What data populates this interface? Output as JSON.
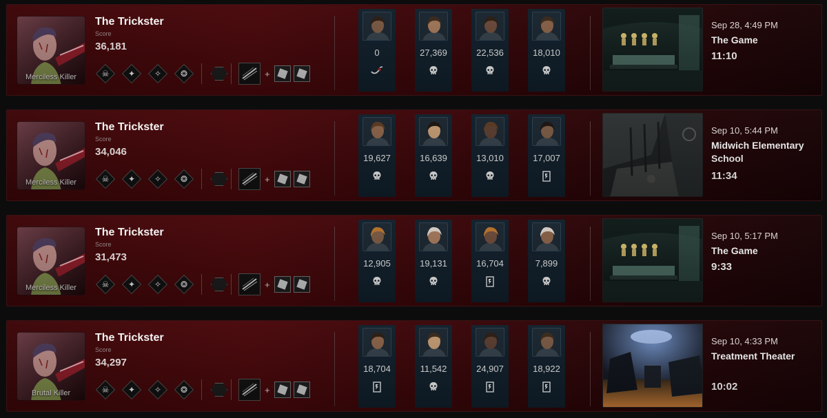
{
  "matches": [
    {
      "killer": "The Trickster",
      "score_label": "Score",
      "score": "36,181",
      "rank": "Merciless Killer",
      "perks": [
        "perk-icon-1",
        "perk-icon-2",
        "perk-icon-3",
        "perk-icon-4"
      ],
      "offering": "offering-icon",
      "power": "power-icon",
      "plus": "+",
      "addons": [
        "addon-icon-1",
        "addon-icon-2"
      ],
      "survivors": [
        {
          "score": "0",
          "status": "hook-icon"
        },
        {
          "score": "27,369",
          "status": "skull-icon"
        },
        {
          "score": "22,536",
          "status": "skull-icon"
        },
        {
          "score": "18,010",
          "status": "skull-icon"
        }
      ],
      "date": "Sep 28, 4:49 PM",
      "map": "The Game",
      "duration": "11:10"
    },
    {
      "killer": "The Trickster",
      "score_label": "Score",
      "score": "34,046",
      "rank": "Merciless Killer",
      "perks": [
        "perk-icon-1",
        "perk-icon-2",
        "perk-icon-3",
        "perk-icon-4"
      ],
      "offering": "offering-icon",
      "power": "power-icon",
      "plus": "+",
      "addons": [
        "addon-icon-1",
        "addon-icon-2"
      ],
      "survivors": [
        {
          "score": "19,627",
          "status": "skull-icon"
        },
        {
          "score": "16,639",
          "status": "skull-icon"
        },
        {
          "score": "13,010",
          "status": "skull-icon"
        },
        {
          "score": "17,007",
          "status": "escape-icon"
        }
      ],
      "date": "Sep 10, 5:44 PM",
      "map": "Midwich Elementary School",
      "duration": "11:34"
    },
    {
      "killer": "The Trickster",
      "score_label": "Score",
      "score": "31,473",
      "rank": "Merciless Killer",
      "perks": [
        "perk-icon-1",
        "perk-icon-2",
        "perk-icon-3",
        "perk-icon-4"
      ],
      "offering": "offering-icon",
      "power": "power-icon",
      "plus": "+",
      "addons": [
        "addon-icon-1",
        "addon-icon-2"
      ],
      "survivors": [
        {
          "score": "12,905",
          "status": "skull-icon"
        },
        {
          "score": "19,131",
          "status": "skull-icon"
        },
        {
          "score": "16,704",
          "status": "escape-icon"
        },
        {
          "score": "7,899",
          "status": "skull-icon"
        }
      ],
      "date": "Sep 10, 5:17 PM",
      "map": "The Game",
      "duration": "9:33"
    },
    {
      "killer": "The Trickster",
      "score_label": "Score",
      "score": "34,297",
      "rank": "Brutal Killer",
      "perks": [
        "perk-icon-1",
        "perk-icon-2",
        "perk-icon-3",
        "perk-icon-4"
      ],
      "offering": "offering-icon",
      "power": "power-icon",
      "plus": "+",
      "addons": [
        "addon-icon-1",
        "addon-icon-2"
      ],
      "survivors": [
        {
          "score": "18,704",
          "status": "escape-icon"
        },
        {
          "score": "11,542",
          "status": "skull-icon"
        },
        {
          "score": "24,907",
          "status": "escape-icon"
        },
        {
          "score": "18,922",
          "status": "escape-icon"
        }
      ],
      "date": "Sep 10, 4:33 PM",
      "map": "Treatment Theater",
      "duration": "10:02"
    }
  ],
  "colors": {
    "card_bg": "#4a080b",
    "survivor_bg": "#11202c",
    "divider": "#5a3a3c"
  }
}
